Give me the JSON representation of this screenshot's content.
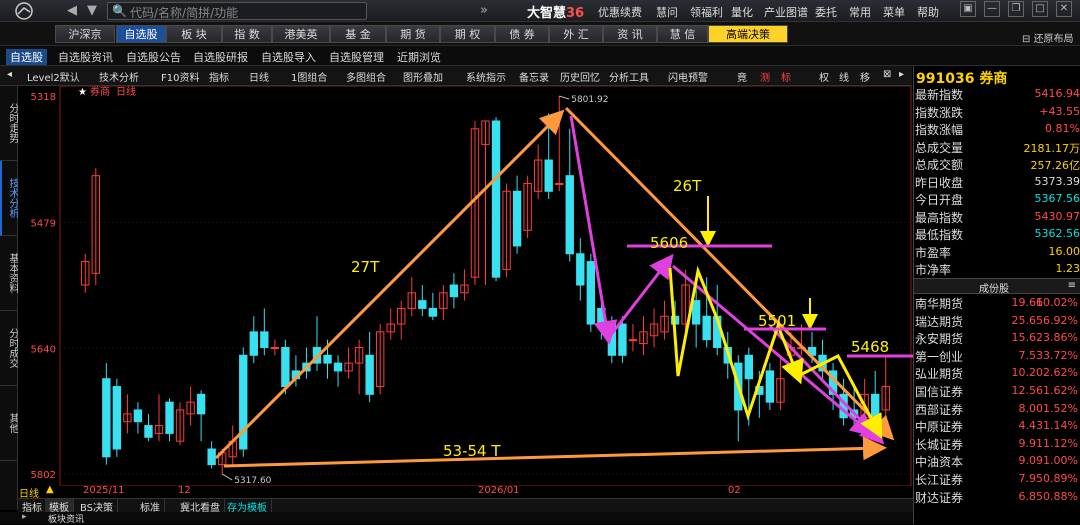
{
  "topbar": {
    "search_placeholder": "代码/名称/简拼/功能",
    "brand": "大智慧",
    "brand_suffix": "36",
    "menu": [
      "优惠续费",
      "慧问",
      "领福利",
      "量化",
      "产业图谱",
      "委托",
      "常用",
      "菜单",
      "帮助"
    ]
  },
  "market_tabs": [
    "沪深京",
    "自选股",
    "板 块",
    "指 数",
    "港美英",
    "基 金",
    "期 货",
    "期 权",
    "债 券",
    "外 汇",
    "资 讯",
    "慧 信",
    "高端决策"
  ],
  "restore_layout": "还原布局",
  "sub_tabs": [
    "自选股",
    "自选股资讯",
    "自选股公告",
    "自选股研报",
    "自选股导入",
    "自选股管理",
    "近期浏览"
  ],
  "toolbar": [
    "Level2默认",
    "技术分析",
    "F10资料",
    "指标",
    "日线",
    "1图组合",
    "多图组合",
    "图形叠加",
    "系统指示",
    "备忘录",
    "历史回忆",
    "分析工具",
    "闪电预警",
    "竟",
    "测",
    "标",
    "权",
    "线",
    "移"
  ],
  "sidebar_tabs": [
    "分时走势",
    "技术分析",
    "基本资料",
    "分时成交",
    "其他"
  ],
  "chart": {
    "title": "券商",
    "period": "日线",
    "y_ticks": [
      "5802",
      "5640",
      "5479",
      "5318"
    ],
    "x_ticks": [
      "2025/11",
      "12",
      "2026/01",
      "02"
    ],
    "high_label": "5801.92",
    "low_label": "5317.60",
    "annotations": [
      "27T",
      "26T",
      "5606",
      "5501",
      "5468",
      "53-54 T"
    ]
  },
  "chart_data": {
    "type": "candlestick",
    "ylim": [
      5318,
      5802
    ],
    "x_ticks": [
      "2025/11",
      "12",
      "2026/01",
      "02"
    ],
    "y_ticks": [
      5318,
      5479,
      5640,
      5802
    ],
    "max": 5801.92,
    "min": 5317.6,
    "series": [
      {
        "o": 5560,
        "c": 5590,
        "h": 5600,
        "l": 5550
      },
      {
        "o": 5575,
        "c": 5700,
        "h": 5710,
        "l": 5560
      },
      {
        "o": 5440,
        "c": 5340,
        "h": 5460,
        "l": 5330
      },
      {
        "o": 5430,
        "c": 5350,
        "h": 5440,
        "l": 5340
      },
      {
        "o": 5385,
        "c": 5395,
        "h": 5420,
        "l": 5370
      },
      {
        "o": 5400,
        "c": 5385,
        "h": 5410,
        "l": 5370
      },
      {
        "o": 5380,
        "c": 5365,
        "h": 5395,
        "l": 5360
      },
      {
        "o": 5370,
        "c": 5380,
        "h": 5420,
        "l": 5360
      },
      {
        "o": 5410,
        "c": 5370,
        "h": 5415,
        "l": 5360
      },
      {
        "o": 5360,
        "c": 5400,
        "h": 5410,
        "l": 5355
      },
      {
        "o": 5395,
        "c": 5410,
        "h": 5430,
        "l": 5380
      },
      {
        "o": 5420,
        "c": 5395,
        "h": 5425,
        "l": 5360
      },
      {
        "o": 5350,
        "c": 5330,
        "h": 5360,
        "l": 5325
      },
      {
        "o": 5330,
        "c": 5345,
        "h": 5350,
        "l": 5318
      },
      {
        "o": 5340,
        "c": 5360,
        "h": 5380,
        "l": 5330
      },
      {
        "o": 5470,
        "c": 5350,
        "h": 5480,
        "l": 5340
      },
      {
        "o": 5500,
        "c": 5470,
        "h": 5520,
        "l": 5460
      },
      {
        "o": 5500,
        "c": 5480,
        "h": 5530,
        "l": 5470
      },
      {
        "o": 5480,
        "c": 5480,
        "h": 5490,
        "l": 5470
      },
      {
        "o": 5480,
        "c": 5430,
        "h": 5490,
        "l": 5420
      },
      {
        "o": 5450,
        "c": 5440,
        "h": 5470,
        "l": 5430
      },
      {
        "o": 5460,
        "c": 5450,
        "h": 5480,
        "l": 5440
      },
      {
        "o": 5480,
        "c": 5460,
        "h": 5520,
        "l": 5450
      },
      {
        "o": 5470,
        "c": 5460,
        "h": 5490,
        "l": 5440
      },
      {
        "o": 5460,
        "c": 5450,
        "h": 5470,
        "l": 5430
      },
      {
        "o": 5450,
        "c": 5460,
        "h": 5480,
        "l": 5440
      },
      {
        "o": 5460,
        "c": 5480,
        "h": 5490,
        "l": 5420
      },
      {
        "o": 5470,
        "c": 5420,
        "h": 5500,
        "l": 5410
      },
      {
        "o": 5430,
        "c": 5500,
        "h": 5510,
        "l": 5420
      },
      {
        "o": 5500,
        "c": 5510,
        "h": 5530,
        "l": 5490
      },
      {
        "o": 5510,
        "c": 5530,
        "h": 5540,
        "l": 5490
      },
      {
        "o": 5530,
        "c": 5550,
        "h": 5570,
        "l": 5520
      },
      {
        "o": 5540,
        "c": 5530,
        "h": 5560,
        "l": 5520
      },
      {
        "o": 5530,
        "c": 5520,
        "h": 5550,
        "l": 5515
      },
      {
        "o": 5530,
        "c": 5550,
        "h": 5560,
        "l": 5515
      },
      {
        "o": 5560,
        "c": 5545,
        "h": 5575,
        "l": 5530
      },
      {
        "o": 5550,
        "c": 5560,
        "h": 5580,
        "l": 5540
      },
      {
        "o": 5570,
        "c": 5760,
        "h": 5770,
        "l": 5560
      },
      {
        "o": 5740,
        "c": 5770,
        "h": 5770,
        "l": 5560
      },
      {
        "o": 5770,
        "c": 5570,
        "h": 5775,
        "l": 5565
      },
      {
        "o": 5580,
        "c": 5680,
        "h": 5690,
        "l": 5570
      },
      {
        "o": 5680,
        "c": 5610,
        "h": 5700,
        "l": 5600
      },
      {
        "o": 5630,
        "c": 5690,
        "h": 5700,
        "l": 5620
      },
      {
        "o": 5680,
        "c": 5720,
        "h": 5740,
        "l": 5670
      },
      {
        "o": 5720,
        "c": 5680,
        "h": 5780,
        "l": 5670
      },
      {
        "o": 5690,
        "c": 5690,
        "h": 5802,
        "l": 5680
      },
      {
        "o": 5700,
        "c": 5600,
        "h": 5760,
        "l": 5590
      },
      {
        "o": 5600,
        "c": 5560,
        "h": 5620,
        "l": 5540
      },
      {
        "o": 5590,
        "c": 5510,
        "h": 5600,
        "l": 5500
      },
      {
        "o": 5530,
        "c": 5510,
        "h": 5540,
        "l": 5490
      },
      {
        "o": 5510,
        "c": 5470,
        "h": 5520,
        "l": 5460
      },
      {
        "o": 5510,
        "c": 5470,
        "h": 5520,
        "l": 5460
      },
      {
        "o": 5490,
        "c": 5490,
        "h": 5510,
        "l": 5475
      },
      {
        "o": 5485,
        "c": 5500,
        "h": 5520,
        "l": 5470
      },
      {
        "o": 5495,
        "c": 5510,
        "h": 5530,
        "l": 5480
      },
      {
        "o": 5500,
        "c": 5520,
        "h": 5540,
        "l": 5490
      },
      {
        "o": 5520,
        "c": 5510,
        "h": 5540,
        "l": 5500
      },
      {
        "o": 5510,
        "c": 5560,
        "h": 5580,
        "l": 5500
      },
      {
        "o": 5540,
        "c": 5510,
        "h": 5560,
        "l": 5480
      },
      {
        "o": 5520,
        "c": 5490,
        "h": 5570,
        "l": 5480
      },
      {
        "o": 5520,
        "c": 5480,
        "h": 5560,
        "l": 5470
      },
      {
        "o": 5480,
        "c": 5460,
        "h": 5500,
        "l": 5440
      },
      {
        "o": 5460,
        "c": 5400,
        "h": 5470,
        "l": 5360
      },
      {
        "o": 5470,
        "c": 5440,
        "h": 5480,
        "l": 5380
      },
      {
        "o": 5430,
        "c": 5420,
        "h": 5450,
        "l": 5390
      },
      {
        "o": 5450,
        "c": 5410,
        "h": 5460,
        "l": 5400
      },
      {
        "o": 5410,
        "c": 5440,
        "h": 5470,
        "l": 5400
      },
      {
        "o": 5470,
        "c": 5480,
        "h": 5500,
        "l": 5460
      },
      {
        "o": 5480,
        "c": 5480,
        "h": 5510,
        "l": 5470
      },
      {
        "o": 5480,
        "c": 5470,
        "h": 5500,
        "l": 5460
      },
      {
        "o": 5470,
        "c": 5450,
        "h": 5490,
        "l": 5440
      },
      {
        "o": 5450,
        "c": 5420,
        "h": 5460,
        "l": 5400
      },
      {
        "o": 5420,
        "c": 5390,
        "h": 5440,
        "l": 5380
      },
      {
        "o": 5400,
        "c": 5390,
        "h": 5430,
        "l": 5380
      },
      {
        "o": 5390,
        "c": 5420,
        "h": 5440,
        "l": 5370
      },
      {
        "o": 5420,
        "c": 5380,
        "h": 5450,
        "l": 5370
      },
      {
        "o": 5400,
        "c": 5430,
        "h": 5470,
        "l": 5390
      }
    ]
  },
  "quote": {
    "code": "991036",
    "name": "券商",
    "rows": [
      {
        "label": "最新指数",
        "value": "5416.94",
        "color": "#ff4b4b"
      },
      {
        "label": "指数涨跌",
        "value": "+43.55",
        "color": "#ff4b4b"
      },
      {
        "label": "指数涨幅",
        "value": "0.81%",
        "color": "#ff4b4b"
      },
      {
        "label": "总成交量",
        "value": "2181.17万",
        "color": "#ffd200"
      },
      {
        "label": "总成交额",
        "value": "257.26亿",
        "color": "#ffd200"
      },
      {
        "label": "昨日收盘",
        "value": "5373.39",
        "color": "#dddddd"
      },
      {
        "label": "今日开盘",
        "value": "5367.56",
        "color": "#00e0e0"
      },
      {
        "label": "最高指数",
        "value": "5430.97",
        "color": "#ff4b4b"
      },
      {
        "label": "最低指数",
        "value": "5362.56",
        "color": "#00e0e0"
      },
      {
        "label": "市盈率",
        "value": "16.00",
        "color": "#ffd200"
      },
      {
        "label": "市净率",
        "value": "1.23",
        "color": "#ffd200"
      }
    ]
  },
  "constituents": {
    "header": "成份股",
    "rows": [
      {
        "name": "南华期货",
        "price": "19.66",
        "pct": "10.02%"
      },
      {
        "name": "瑞达期货",
        "price": "25.65",
        "pct": "6.92%"
      },
      {
        "name": "永安期货",
        "price": "15.62",
        "pct": "3.86%"
      },
      {
        "name": "第一创业",
        "price": "7.53",
        "pct": "3.72%"
      },
      {
        "name": "弘业期货",
        "price": "10.20",
        "pct": "2.62%"
      },
      {
        "name": "国信证券",
        "price": "12.56",
        "pct": "1.62%"
      },
      {
        "name": "西部证券",
        "price": "8.00",
        "pct": "1.52%"
      },
      {
        "name": "中原证券",
        "price": "4.43",
        "pct": "1.14%"
      },
      {
        "name": "长城证券",
        "price": "9.91",
        "pct": "1.12%"
      },
      {
        "name": "中油资本",
        "price": "9.09",
        "pct": "1.00%"
      },
      {
        "name": "长江证券",
        "price": "7.95",
        "pct": "0.89%"
      },
      {
        "name": "财达证券",
        "price": "6.85",
        "pct": "0.88%"
      }
    ]
  },
  "bottom_tabs": [
    "指标",
    "模板",
    "BS决策",
    "标准",
    "冀北看盘",
    "存为模板"
  ],
  "period_label": "日线",
  "news_tab": "板块资讯"
}
